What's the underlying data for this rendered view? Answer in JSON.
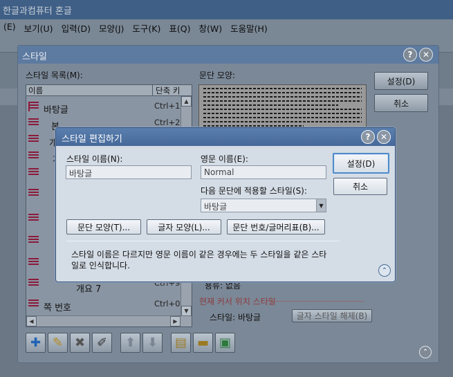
{
  "app": {
    "title": "한글과컴퓨터 혼글",
    "menu": [
      "(E)",
      "보기(U)",
      "입력(D)",
      "모양(J)",
      "도구(K)",
      "표(Q)",
      "창(W)",
      "도움말(H)"
    ]
  },
  "style_dialog": {
    "title": "스타일",
    "list_label": "스타일 목록(M):",
    "col_name": "이름",
    "col_shortcut": "단축 키",
    "items": [
      {
        "name": "바탕글",
        "key": "Ctrl+1"
      },
      {
        "name": "본",
        "key": "Ctrl+2"
      },
      {
        "name": "개",
        "key": ""
      },
      {
        "name": "개",
        "key": ""
      },
      {
        "name": "",
        "key": ""
      },
      {
        "name": "",
        "key": ""
      },
      {
        "name": "",
        "key": ""
      },
      {
        "name": "",
        "key": ""
      },
      {
        "name": "",
        "key": ""
      },
      {
        "name": "개요 7",
        "key": "Ctrl+9"
      },
      {
        "name": "쪽 번호",
        "key": "Ctrl+0"
      }
    ],
    "preview_label": "문단 모양:",
    "set_button": "설정(D)",
    "cancel_button": "취소",
    "partial_label": "용류: 없음",
    "current_title": "현재 커서 위치 스타일",
    "current_style_label": "스타일: 바탕글",
    "release_button": "글자 스타일 해제(B)"
  },
  "edit_dialog": {
    "title": "스타일 편집하기",
    "name_label": "스타일 이름(N):",
    "name_value": "바탕글",
    "eng_label": "영문 이름(E):",
    "eng_value": "Normal",
    "next_label": "다음 문단에 적용할 스타일(S):",
    "next_value": "바탕글",
    "set_button": "설정(D)",
    "cancel_button": "취소",
    "para_shape_button": "문단 모양(T)...",
    "char_shape_button": "글자 모양(L)...",
    "numbering_button": "문단 번호/글머리표(B)...",
    "note": "스타일 이름은 다르지만 영문 이름이 같은 경우에는 두 스타일을 같은 스타일로 인식합니다."
  }
}
